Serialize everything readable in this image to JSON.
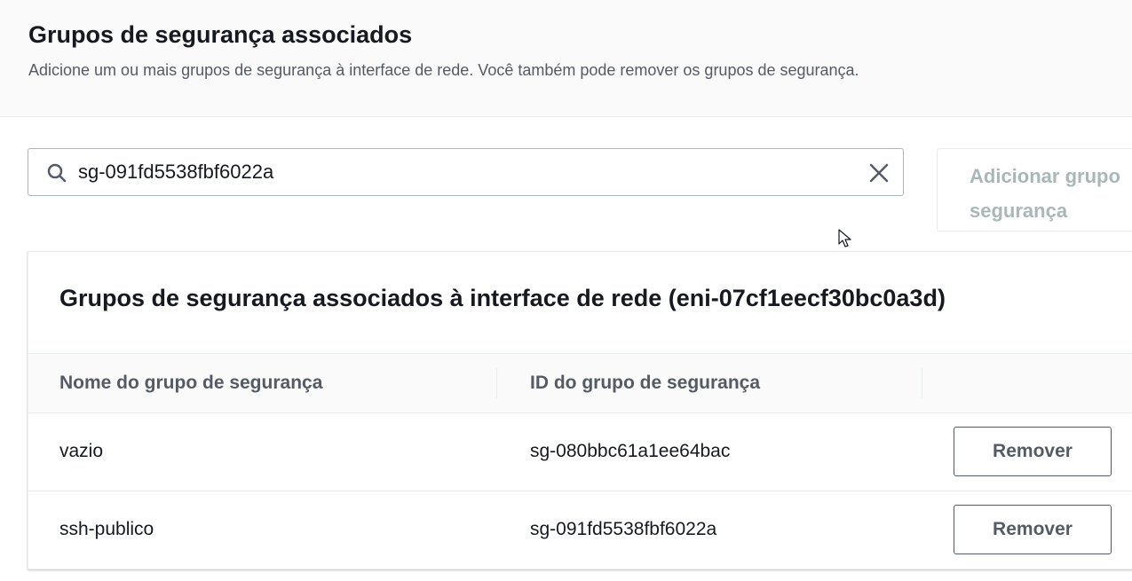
{
  "section": {
    "title": "Grupos de segurança associados",
    "description": "Adicione um ou mais grupos de segurança à interface de rede. Você também pode remover os grupos de segurança."
  },
  "search": {
    "value": "sg-091fd5538fbf6022a",
    "icon": "search-icon",
    "clear_icon": "close-icon"
  },
  "add_button": {
    "line1": "Adicionar grupo",
    "line2": "segurança"
  },
  "table": {
    "title": "Grupos de segurança associados à interface de rede (eni-07cf1eecf30bc0a3d)",
    "columns": [
      "Nome do grupo de segurança",
      "ID do grupo de segurança"
    ],
    "rows": [
      {
        "name": "vazio",
        "id": "sg-080bbc61a1ee64bac",
        "action": "Remover"
      },
      {
        "name": "ssh-publico",
        "id": "sg-091fd5538fbf6022a",
        "action": "Remover"
      }
    ]
  },
  "colors": {
    "primary_text": "#16191f",
    "secondary_text": "#545b64",
    "disabled_text": "#aab7b8",
    "border": "#aab7b8",
    "divider": "#eaeded"
  }
}
